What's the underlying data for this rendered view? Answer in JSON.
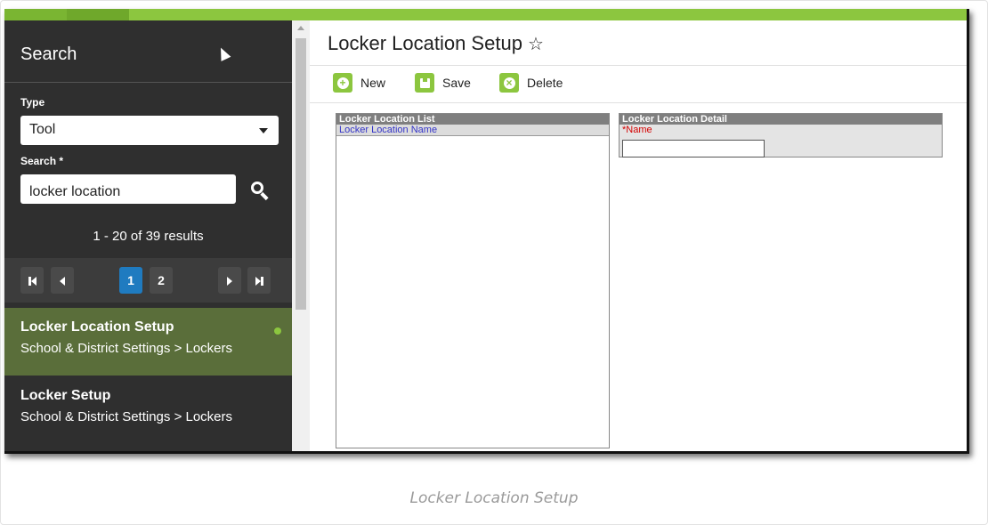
{
  "sidebar": {
    "title": "Search",
    "type_label": "Type",
    "type_value": "Tool",
    "search_label": "Search *",
    "search_value": "locker location",
    "results_text": "1 - 20 of 39 results",
    "pages": [
      "1",
      "2"
    ],
    "results": [
      {
        "title": "Locker Location Setup",
        "path": "School & District Settings > Lockers",
        "selected": true
      },
      {
        "title": "Locker Setup",
        "path": "School & District Settings > Lockers",
        "selected": false
      }
    ]
  },
  "main": {
    "title": "Locker Location Setup",
    "star_icon": "☆",
    "toolbar": {
      "new_label": "New",
      "save_label": "Save",
      "delete_label": "Delete"
    },
    "list_panel": {
      "header": "Locker Location List",
      "column": "Locker Location Name"
    },
    "detail_panel": {
      "header": "Locker Location Detail",
      "name_label": "*Name",
      "name_value": ""
    }
  },
  "caption": "Locker Location Setup",
  "colors": {
    "accent_green": "#8cc63f",
    "active_page": "#1f7bc0",
    "sidebar_bg": "#2f2f2f",
    "selected_item": "#5a6e3a"
  }
}
